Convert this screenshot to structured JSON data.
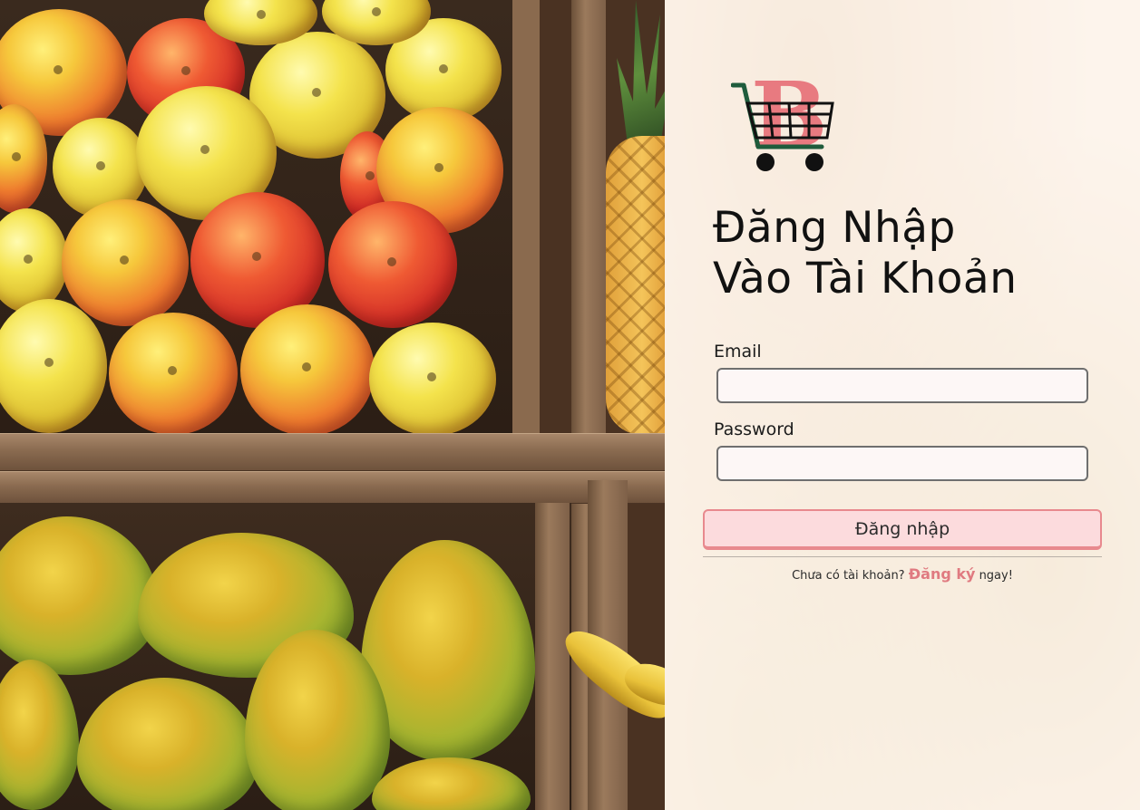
{
  "colors": {
    "accent": "#e07a80",
    "button_bg": "#fcdbdd",
    "button_border": "#e8898e",
    "cart_green": "#1f5c3c",
    "logo_pink": "#e87a80"
  },
  "logo": {
    "letter": "B",
    "icon": "shopping-cart-icon"
  },
  "login": {
    "title_line1": "Đăng Nhập",
    "title_line2": "Vào Tài Khoản",
    "email_label": "Email",
    "email_value": "",
    "password_label": "Password",
    "password_value": "",
    "submit_label": "Đăng nhập",
    "signup_prefix": "Chưa có tài khoản?",
    "signup_link": "Đăng ký",
    "signup_suffix": "ngay!"
  }
}
